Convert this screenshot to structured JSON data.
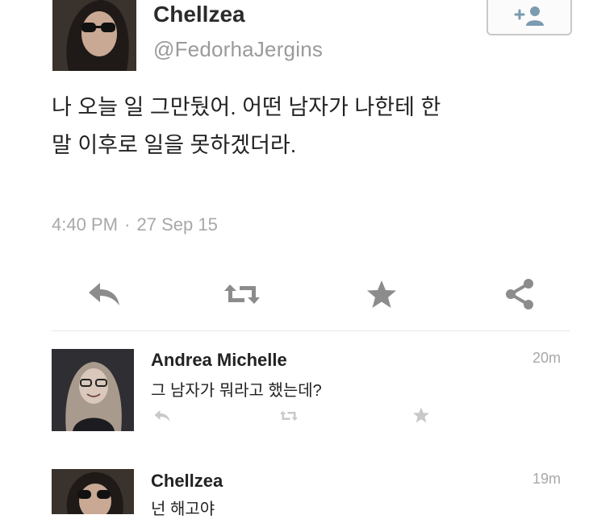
{
  "tweet": {
    "author_name": "Chellzea",
    "author_handle": "@FedorhaJergins",
    "text_line1": "나 오늘 일 그만뒀어. 어떤 남자가 나한테 한",
    "text_line2": "말 이후로 일을 못하겠더라.",
    "time": "4:40 PM",
    "separator": "·",
    "date": "27 Sep 15",
    "follow_icon": "add-user-icon"
  },
  "actions": [
    "reply-icon",
    "retweet-icon",
    "favorite-icon",
    "share-icon"
  ],
  "replies": [
    {
      "name": "Andrea Michelle",
      "text": "그 남자가 뭐라고 했는데?",
      "time": "20m"
    },
    {
      "name": "Chellzea",
      "text": "넌 해고야",
      "time": "19m"
    }
  ],
  "colors": {
    "icon_gray": "#8c8c8c",
    "muted_text": "#a8a8a8"
  }
}
